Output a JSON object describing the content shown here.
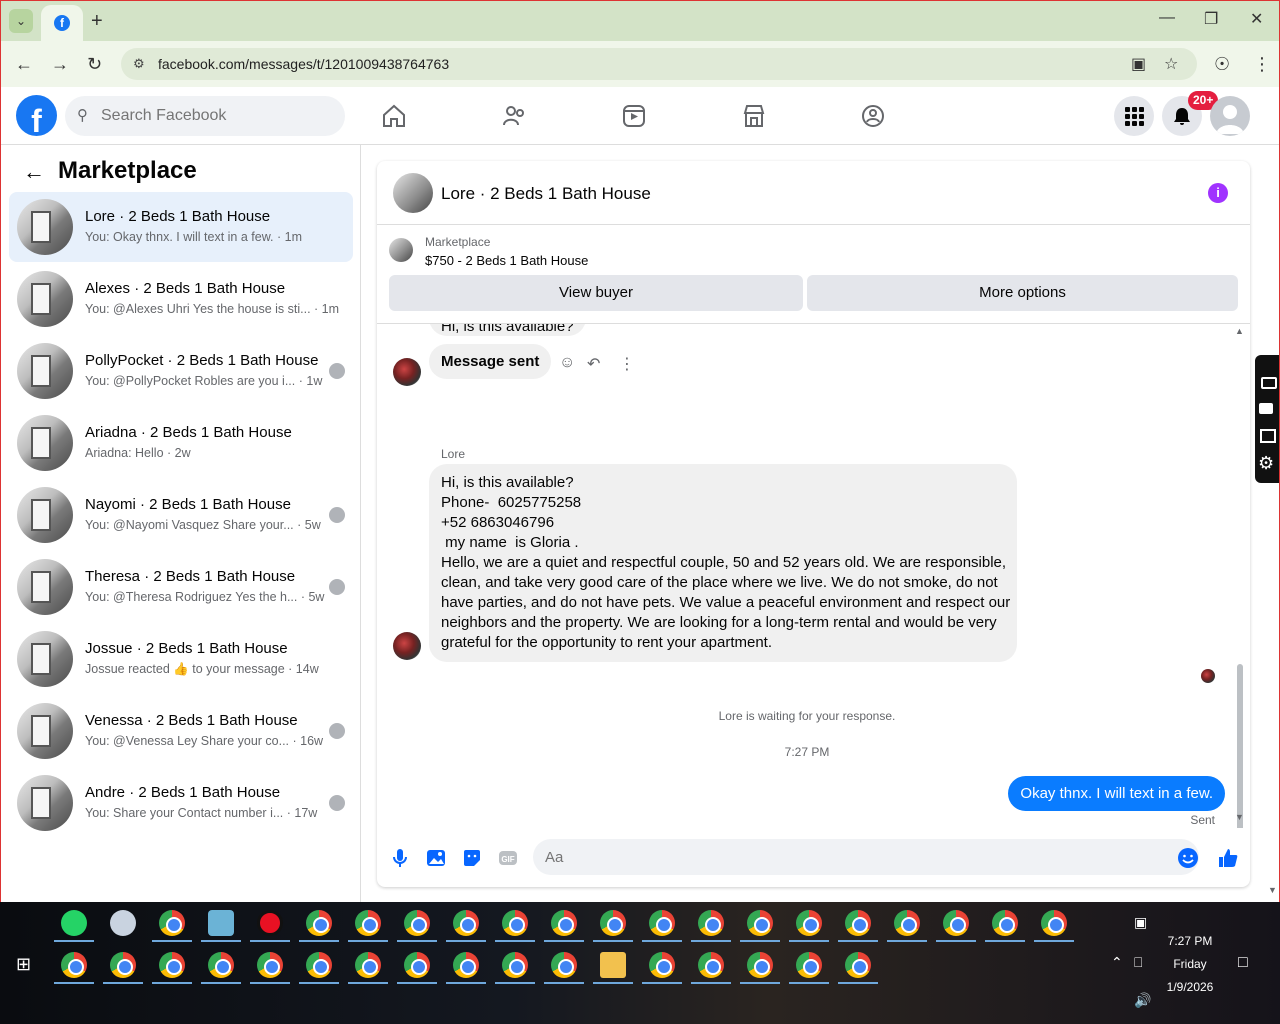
{
  "browser": {
    "tab_title": "Facebook",
    "url": "facebook.com/messages/t/1201009438764763"
  },
  "fb": {
    "search_placeholder": "Search Facebook",
    "notification_badge": "20+"
  },
  "left": {
    "title": "Marketplace",
    "conversations": [
      {
        "title": "Lore · 2 Beds 1 Bath House",
        "preview": "You: Okay thnx. I will text in a few. · 1m",
        "active": true
      },
      {
        "title": "Alexes · 2 Beds 1 Bath House",
        "preview": "You: @Alexes Uhri Yes the house is sti... · 1m"
      },
      {
        "title": "PollyPocket · 2 Beds 1 Bath House",
        "preview": "You: @PollyPocket Robles are you i... · 1w"
      },
      {
        "title": "Ariadna · 2 Beds 1 Bath House",
        "preview": "Ariadna: Hello · 2w"
      },
      {
        "title": "Nayomi · 2 Beds 1 Bath House",
        "preview": "You: @Nayomi Vasquez Share your... · 5w"
      },
      {
        "title": "Theresa · 2 Beds 1 Bath House",
        "preview": "You: @Theresa Rodriguez Yes the h... · 5w"
      },
      {
        "title": "Jossue · 2 Beds 1 Bath House",
        "preview": "Jossue reacted 👍 to your message · 14w"
      },
      {
        "title": "Venessa · 2 Beds 1 Bath House",
        "preview": "You: @Venessa Ley Share your co... · 16w"
      },
      {
        "title": "Andre · 2 Beds 1 Bath House",
        "preview": "You: Share your Contact number i... · 17w"
      }
    ]
  },
  "chat": {
    "title": "Lore · 2 Beds 1 Bath House",
    "marketplace_label": "Marketplace",
    "listing": "$750 - 2 Beds 1 Bath House",
    "view_buyer": "View buyer",
    "more_options": "More options",
    "partial_message": "Hi, is this available?",
    "message_sent": "Message sent",
    "sender_name": "Lore",
    "long_message_lines": [
      "Hi, is this available?",
      "Phone-  6025775258",
      "+52 6863046796",
      " my name  is Gloria .",
      "Hello, we are a quiet and respectful couple, 50 and 52 years old. We are responsible,",
      "clean, and take very good care of the place where we live. We do not smoke, do not",
      "have parties, and do not have pets. We value a peaceful environment and respect our",
      "neighbors and the property. We are looking for a long-term rental and would be very",
      "grateful for the opportunity to rent your apartment."
    ],
    "waiting_text": "Lore is waiting for your response.",
    "timestamp": "7:27 PM",
    "my_message": "Okay thnx. I will text in a few.",
    "sent_status": "Sent",
    "composer_placeholder": "Aa"
  },
  "taskbar": {
    "time": "7:27 PM",
    "day": "Friday",
    "date": "1/9/2026"
  }
}
